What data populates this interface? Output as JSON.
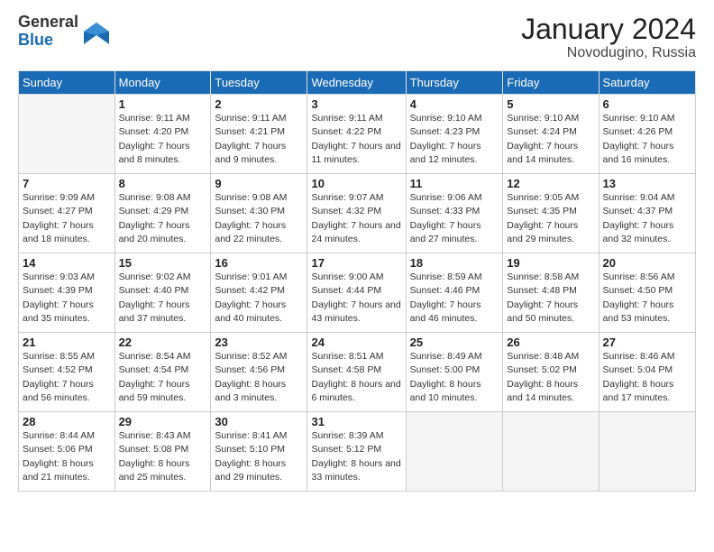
{
  "logo": {
    "general": "General",
    "blue": "Blue"
  },
  "header": {
    "month_year": "January 2024",
    "location": "Novodugino, Russia"
  },
  "weekdays": [
    "Sunday",
    "Monday",
    "Tuesday",
    "Wednesday",
    "Thursday",
    "Friday",
    "Saturday"
  ],
  "weeks": [
    [
      {
        "day": "",
        "sunrise": "",
        "sunset": "",
        "daylight": ""
      },
      {
        "day": "1",
        "sunrise": "Sunrise: 9:11 AM",
        "sunset": "Sunset: 4:20 PM",
        "daylight": "Daylight: 7 hours and 8 minutes."
      },
      {
        "day": "2",
        "sunrise": "Sunrise: 9:11 AM",
        "sunset": "Sunset: 4:21 PM",
        "daylight": "Daylight: 7 hours and 9 minutes."
      },
      {
        "day": "3",
        "sunrise": "Sunrise: 9:11 AM",
        "sunset": "Sunset: 4:22 PM",
        "daylight": "Daylight: 7 hours and 11 minutes."
      },
      {
        "day": "4",
        "sunrise": "Sunrise: 9:10 AM",
        "sunset": "Sunset: 4:23 PM",
        "daylight": "Daylight: 7 hours and 12 minutes."
      },
      {
        "day": "5",
        "sunrise": "Sunrise: 9:10 AM",
        "sunset": "Sunset: 4:24 PM",
        "daylight": "Daylight: 7 hours and 14 minutes."
      },
      {
        "day": "6",
        "sunrise": "Sunrise: 9:10 AM",
        "sunset": "Sunset: 4:26 PM",
        "daylight": "Daylight: 7 hours and 16 minutes."
      }
    ],
    [
      {
        "day": "7",
        "sunrise": "Sunrise: 9:09 AM",
        "sunset": "Sunset: 4:27 PM",
        "daylight": "Daylight: 7 hours and 18 minutes."
      },
      {
        "day": "8",
        "sunrise": "Sunrise: 9:08 AM",
        "sunset": "Sunset: 4:29 PM",
        "daylight": "Daylight: 7 hours and 20 minutes."
      },
      {
        "day": "9",
        "sunrise": "Sunrise: 9:08 AM",
        "sunset": "Sunset: 4:30 PM",
        "daylight": "Daylight: 7 hours and 22 minutes."
      },
      {
        "day": "10",
        "sunrise": "Sunrise: 9:07 AM",
        "sunset": "Sunset: 4:32 PM",
        "daylight": "Daylight: 7 hours and 24 minutes."
      },
      {
        "day": "11",
        "sunrise": "Sunrise: 9:06 AM",
        "sunset": "Sunset: 4:33 PM",
        "daylight": "Daylight: 7 hours and 27 minutes."
      },
      {
        "day": "12",
        "sunrise": "Sunrise: 9:05 AM",
        "sunset": "Sunset: 4:35 PM",
        "daylight": "Daylight: 7 hours and 29 minutes."
      },
      {
        "day": "13",
        "sunrise": "Sunrise: 9:04 AM",
        "sunset": "Sunset: 4:37 PM",
        "daylight": "Daylight: 7 hours and 32 minutes."
      }
    ],
    [
      {
        "day": "14",
        "sunrise": "Sunrise: 9:03 AM",
        "sunset": "Sunset: 4:39 PM",
        "daylight": "Daylight: 7 hours and 35 minutes."
      },
      {
        "day": "15",
        "sunrise": "Sunrise: 9:02 AM",
        "sunset": "Sunset: 4:40 PM",
        "daylight": "Daylight: 7 hours and 37 minutes."
      },
      {
        "day": "16",
        "sunrise": "Sunrise: 9:01 AM",
        "sunset": "Sunset: 4:42 PM",
        "daylight": "Daylight: 7 hours and 40 minutes."
      },
      {
        "day": "17",
        "sunrise": "Sunrise: 9:00 AM",
        "sunset": "Sunset: 4:44 PM",
        "daylight": "Daylight: 7 hours and 43 minutes."
      },
      {
        "day": "18",
        "sunrise": "Sunrise: 8:59 AM",
        "sunset": "Sunset: 4:46 PM",
        "daylight": "Daylight: 7 hours and 46 minutes."
      },
      {
        "day": "19",
        "sunrise": "Sunrise: 8:58 AM",
        "sunset": "Sunset: 4:48 PM",
        "daylight": "Daylight: 7 hours and 50 minutes."
      },
      {
        "day": "20",
        "sunrise": "Sunrise: 8:56 AM",
        "sunset": "Sunset: 4:50 PM",
        "daylight": "Daylight: 7 hours and 53 minutes."
      }
    ],
    [
      {
        "day": "21",
        "sunrise": "Sunrise: 8:55 AM",
        "sunset": "Sunset: 4:52 PM",
        "daylight": "Daylight: 7 hours and 56 minutes."
      },
      {
        "day": "22",
        "sunrise": "Sunrise: 8:54 AM",
        "sunset": "Sunset: 4:54 PM",
        "daylight": "Daylight: 7 hours and 59 minutes."
      },
      {
        "day": "23",
        "sunrise": "Sunrise: 8:52 AM",
        "sunset": "Sunset: 4:56 PM",
        "daylight": "Daylight: 8 hours and 3 minutes."
      },
      {
        "day": "24",
        "sunrise": "Sunrise: 8:51 AM",
        "sunset": "Sunset: 4:58 PM",
        "daylight": "Daylight: 8 hours and 6 minutes."
      },
      {
        "day": "25",
        "sunrise": "Sunrise: 8:49 AM",
        "sunset": "Sunset: 5:00 PM",
        "daylight": "Daylight: 8 hours and 10 minutes."
      },
      {
        "day": "26",
        "sunrise": "Sunrise: 8:48 AM",
        "sunset": "Sunset: 5:02 PM",
        "daylight": "Daylight: 8 hours and 14 minutes."
      },
      {
        "day": "27",
        "sunrise": "Sunrise: 8:46 AM",
        "sunset": "Sunset: 5:04 PM",
        "daylight": "Daylight: 8 hours and 17 minutes."
      }
    ],
    [
      {
        "day": "28",
        "sunrise": "Sunrise: 8:44 AM",
        "sunset": "Sunset: 5:06 PM",
        "daylight": "Daylight: 8 hours and 21 minutes."
      },
      {
        "day": "29",
        "sunrise": "Sunrise: 8:43 AM",
        "sunset": "Sunset: 5:08 PM",
        "daylight": "Daylight: 8 hours and 25 minutes."
      },
      {
        "day": "30",
        "sunrise": "Sunrise: 8:41 AM",
        "sunset": "Sunset: 5:10 PM",
        "daylight": "Daylight: 8 hours and 29 minutes."
      },
      {
        "day": "31",
        "sunrise": "Sunrise: 8:39 AM",
        "sunset": "Sunset: 5:12 PM",
        "daylight": "Daylight: 8 hours and 33 minutes."
      },
      {
        "day": "",
        "sunrise": "",
        "sunset": "",
        "daylight": ""
      },
      {
        "day": "",
        "sunrise": "",
        "sunset": "",
        "daylight": ""
      },
      {
        "day": "",
        "sunrise": "",
        "sunset": "",
        "daylight": ""
      }
    ]
  ]
}
